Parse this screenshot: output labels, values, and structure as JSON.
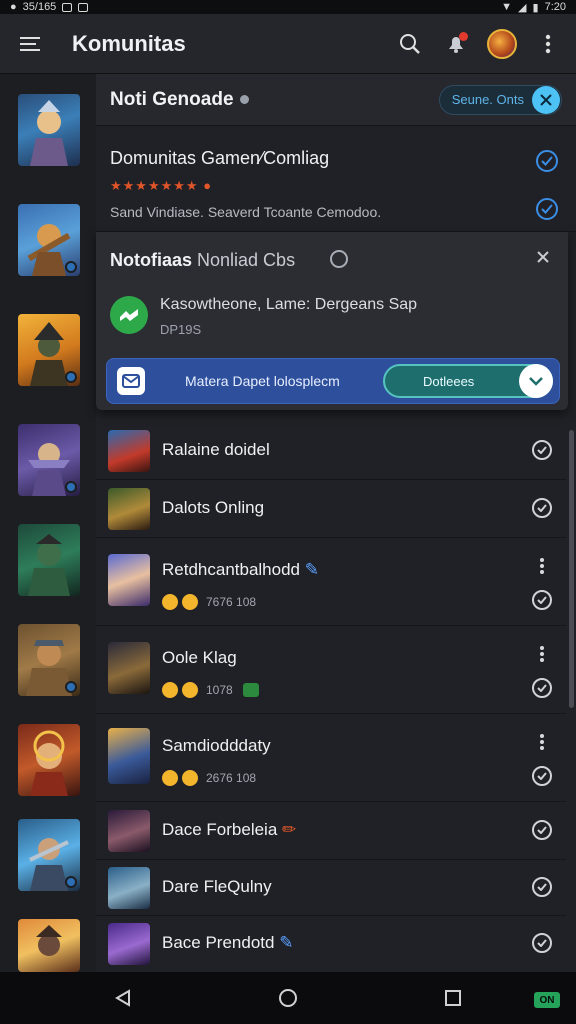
{
  "status": {
    "left_text": "35/165",
    "right_text": "7:20"
  },
  "app": {
    "title": "Komunitas"
  },
  "header": {
    "section_label": "Noti Genoade",
    "pill_label": "Seune. Onts"
  },
  "card": {
    "title": "Domunitas Gamen⁄Comliag",
    "sub": "Sand Vindiase. Seaverd Tcoante Cemodoo."
  },
  "notification": {
    "title_bold": "Notofiaas",
    "title_rest": " Nonliad Cbs",
    "message": "Kasowtheone, Lame: Dergeans Sap",
    "message_sub": "DP19S",
    "action_text": "Matera Dapet lolosplecm",
    "action_button": "Dotleees"
  },
  "list": [
    {
      "name": "Ralaine doidel",
      "meta": null,
      "has_more": false
    },
    {
      "name": "Dalots Onling",
      "meta": null,
      "has_more": false
    },
    {
      "name": "Retdhcantbalhodd",
      "meta": "7676 108",
      "has_more": true,
      "extra": "pen"
    },
    {
      "name": "Oole Klag",
      "meta": "1078",
      "has_more": true,
      "green": true
    },
    {
      "name": "Samdiodddaty",
      "meta": "2676 108",
      "has_more": true
    },
    {
      "name": "Dace Forbeleia",
      "meta": null,
      "has_more": false,
      "extra": "pencil"
    },
    {
      "name": "Dare FleQulny",
      "meta": null,
      "has_more": false
    },
    {
      "name": "Bace Prendotd",
      "meta": null,
      "has_more": false,
      "extra": "pen"
    }
  ],
  "nav": {
    "badge": "ON"
  },
  "colors": {
    "accent_blue": "#3b8ee6",
    "action_blue": "#2d4f9c",
    "teal": "#1f6e6e",
    "green": "#2ea94a"
  }
}
